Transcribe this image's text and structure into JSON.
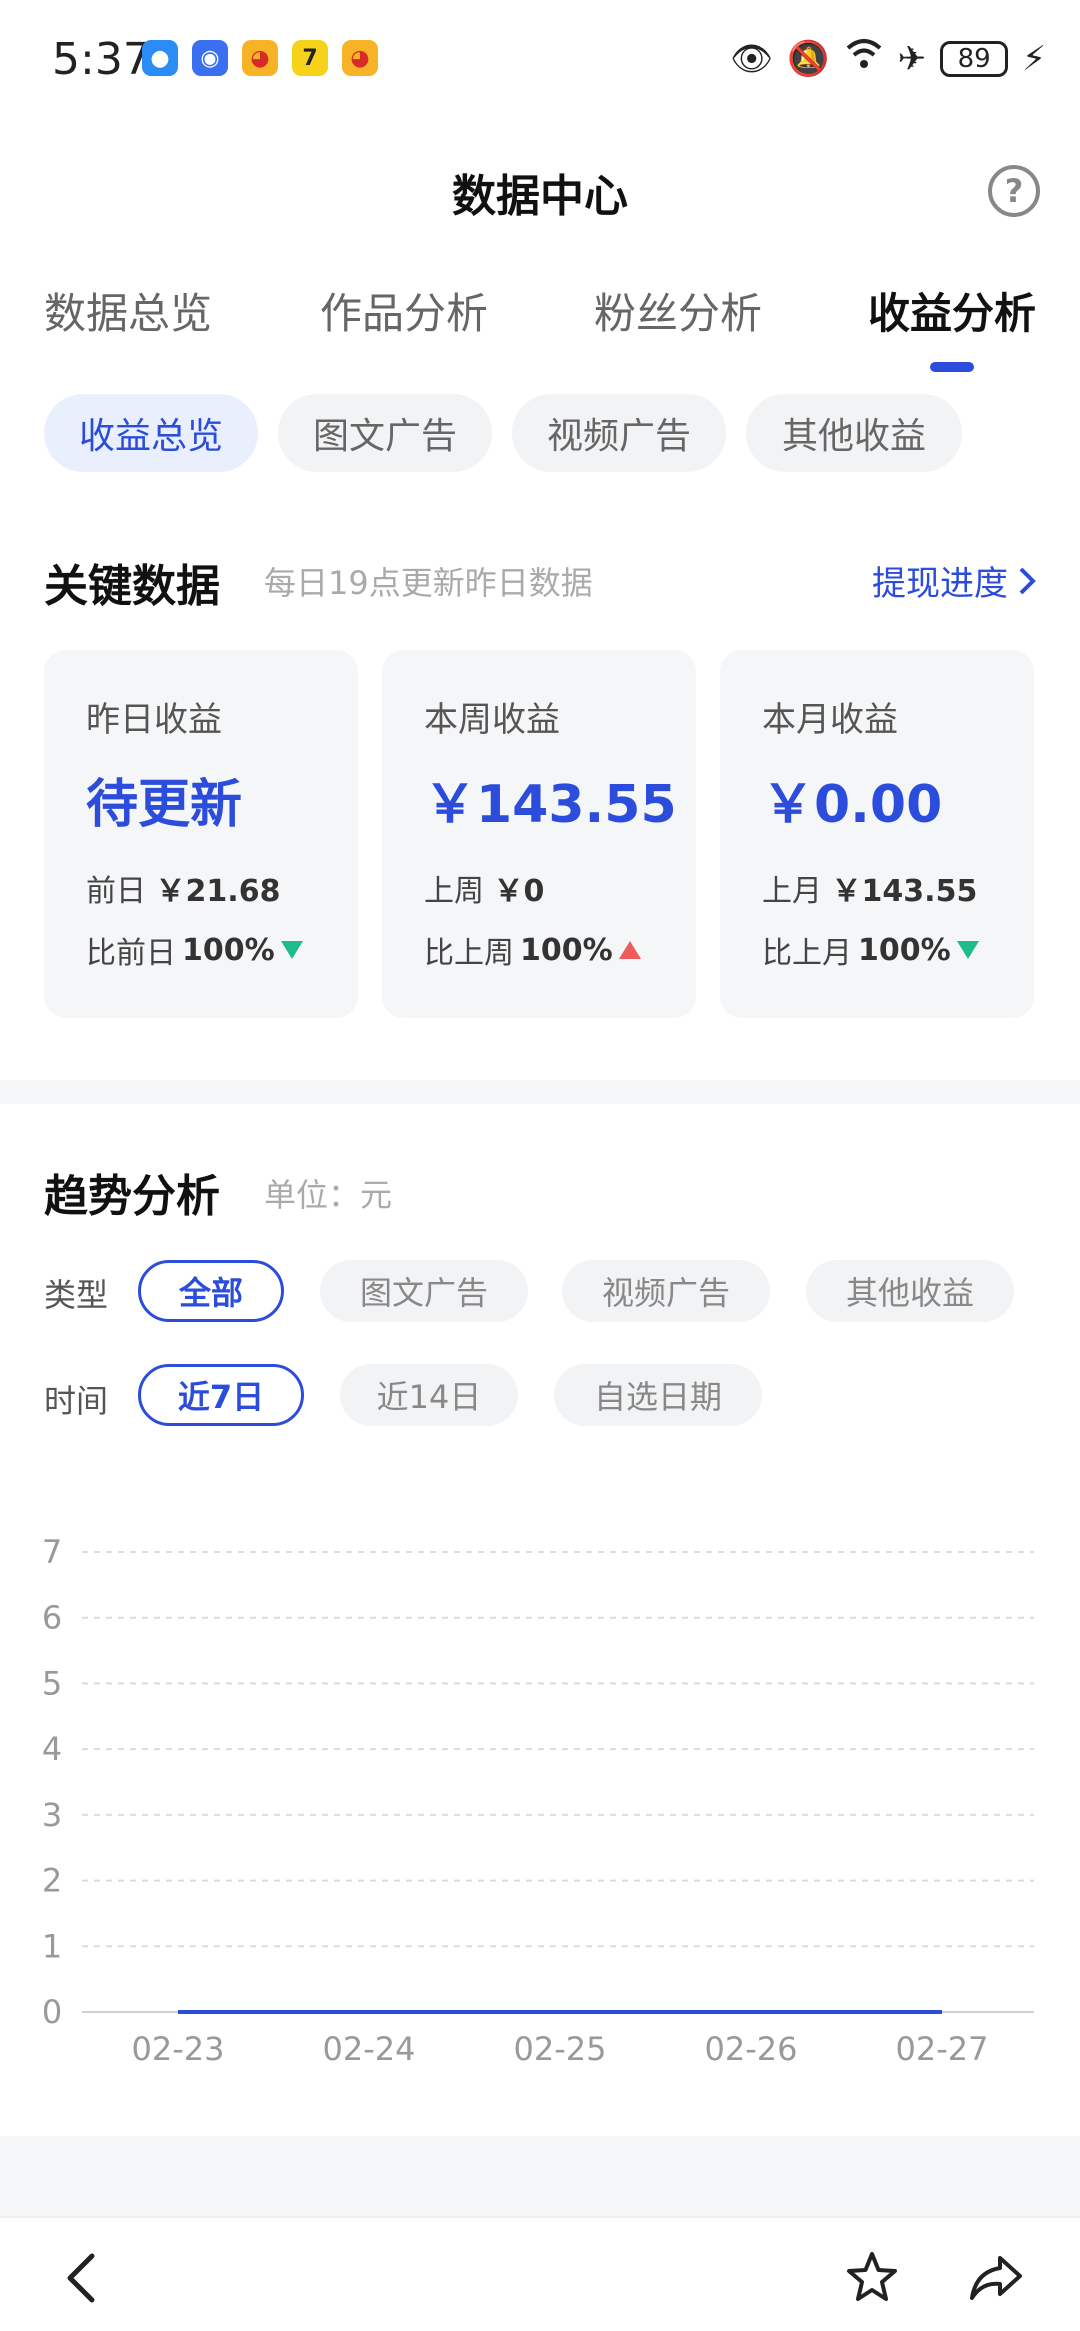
{
  "status_bar": {
    "time": "5:37",
    "battery": "89",
    "signal_note": "6"
  },
  "header": {
    "title": "数据中心",
    "help": "?"
  },
  "main_tabs": [
    {
      "label": "数据总览",
      "active": false
    },
    {
      "label": "作品分析",
      "active": false
    },
    {
      "label": "粉丝分析",
      "active": false
    },
    {
      "label": "收益分析",
      "active": true
    }
  ],
  "sub_tabs": [
    {
      "label": "收益总览",
      "active": true
    },
    {
      "label": "图文广告",
      "active": false
    },
    {
      "label": "视频广告",
      "active": false
    },
    {
      "label": "其他收益",
      "active": false
    }
  ],
  "key_data": {
    "title": "关键数据",
    "note": "每日19点更新昨日数据",
    "withdraw_link": "提现进度",
    "cards": [
      {
        "label": "昨日收益",
        "value": "待更新",
        "prev_label": "前日",
        "prev_value": "￥21.68",
        "compare_label": "比前日",
        "compare_value": "100%",
        "trend": "down"
      },
      {
        "label": "本周收益",
        "value": "￥143.55",
        "prev_label": "上周",
        "prev_value": "￥0",
        "compare_label": "比上周",
        "compare_value": "100%",
        "trend": "up"
      },
      {
        "label": "本月收益",
        "value": "￥0.00",
        "prev_label": "上月",
        "prev_value": "￥143.55",
        "compare_label": "比上月",
        "compare_value": "100%",
        "trend": "down"
      }
    ]
  },
  "trend": {
    "title": "趋势分析",
    "unit": "单位：元",
    "type_label": "类型",
    "type_options": [
      {
        "label": "全部",
        "active": true
      },
      {
        "label": "图文广告",
        "active": false
      },
      {
        "label": "视频广告",
        "active": false
      },
      {
        "label": "其他收益",
        "active": false
      }
    ],
    "time_label": "时间",
    "time_options": [
      {
        "label": "近7日",
        "active": true
      },
      {
        "label": "近14日",
        "active": false
      },
      {
        "label": "自选日期",
        "active": false
      }
    ]
  },
  "chart_data": {
    "type": "line",
    "x": [
      "02-23",
      "02-24",
      "02-25",
      "02-26",
      "02-27"
    ],
    "series": [
      {
        "values": [
          0,
          0,
          0,
          0,
          0
        ],
        "color": "#2c4ddb"
      }
    ],
    "ylim": [
      0,
      7
    ],
    "yticks": [
      0,
      1,
      2,
      3,
      4,
      5,
      6,
      7
    ],
    "grid": true
  },
  "colors": {
    "accent": "#2c4ddb",
    "down": "#1ebc8c",
    "up": "#ef5a5a"
  }
}
